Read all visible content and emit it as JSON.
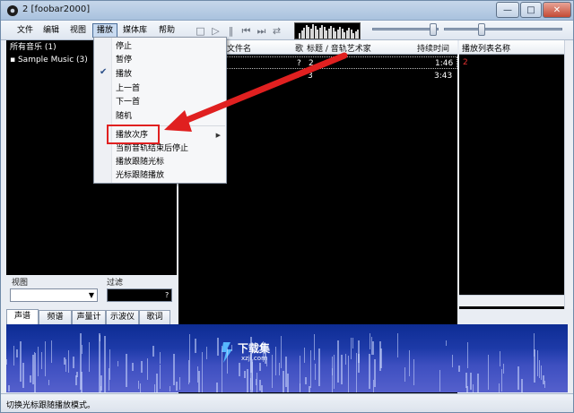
{
  "window": {
    "title": "2  [foobar2000]",
    "controls": {
      "minimize": "—",
      "maximize": "□",
      "close": "✕"
    }
  },
  "menubar": {
    "items": [
      "文件",
      "编辑",
      "视图",
      "播放",
      "媒体库",
      "帮助"
    ],
    "active_index": 3
  },
  "library": {
    "items": [
      {
        "label": "所有音乐 (1)"
      },
      {
        "label": "Sample Music (3)"
      }
    ]
  },
  "playlist": {
    "columns": [
      "文件名",
      "歌",
      "标题 / 音轨艺术家",
      "持续时间"
    ],
    "rows": [
      {
        "mark": "?",
        "track": "2",
        "duration": "1:46"
      },
      {
        "mark": "?",
        "track": "3",
        "duration": "3:43"
      }
    ]
  },
  "playlist_manager": {
    "header": "播放列表名称",
    "items": [
      "2"
    ]
  },
  "view_filter": {
    "view_label": "视图",
    "filter_label": "过滤",
    "filter_hint": "?"
  },
  "tabs": [
    "声谱",
    "频谱",
    "声量计",
    "示波仪",
    "歌词"
  ],
  "active_tab": 0,
  "watermark": {
    "text": "下载集",
    "sub": "xzji.com"
  },
  "status": {
    "text": "切换光标跟随播放模式。"
  },
  "playback_menu": {
    "items": [
      {
        "label": "停止"
      },
      {
        "label": "暂停"
      },
      {
        "label": "播放",
        "checked": true
      },
      {
        "label": "上一首"
      },
      {
        "label": "下一首"
      },
      {
        "label": "随机"
      },
      {
        "label": "播放次序",
        "submenu": true
      },
      {
        "label": "当前音轨结束后停止"
      },
      {
        "label": "播放跟随光标"
      },
      {
        "label": "光标跟随播放"
      }
    ]
  },
  "colors": {
    "highlight": "#e02020",
    "arrow": "#e02020"
  },
  "icons": [
    "stop-icon",
    "play-icon",
    "pause-icon",
    "previous-icon",
    "next-icon",
    "random-icon"
  ]
}
